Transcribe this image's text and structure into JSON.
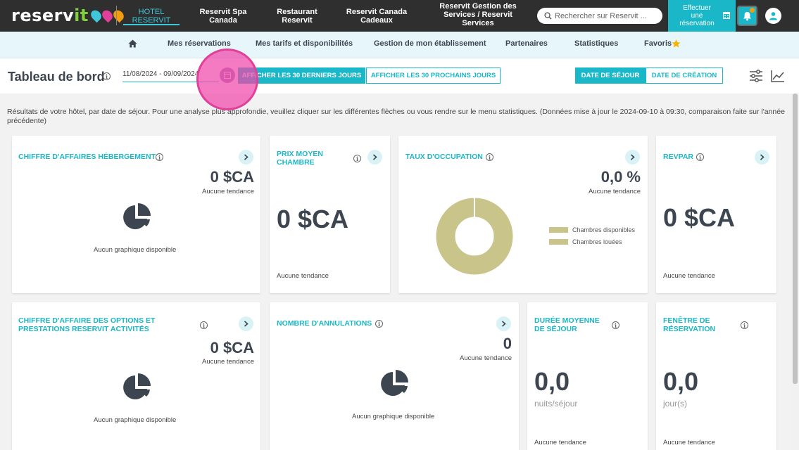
{
  "header": {
    "logo_text_a": "reserv",
    "logo_text_b": "it",
    "nav": [
      {
        "label_line1": "HOTEL",
        "label_line2": "RESERVIT",
        "active": true
      },
      {
        "label_line1": "Reservit Spa",
        "label_line2": "Canada"
      },
      {
        "label_line1": "Restaurant",
        "label_line2": "Reservit"
      },
      {
        "label_line1": "Reservit Canada",
        "label_line2": "Cadeaux"
      },
      {
        "label_line1": "Reservit Gestion des",
        "label_line2": "Services / Reservit",
        "label_line3": "Services"
      }
    ],
    "search_placeholder": "Rechercher sur Reservit ...",
    "reserve_button": {
      "line1": "Effectuer",
      "line2": "une",
      "line3": "réservation"
    }
  },
  "subnav": [
    "Mes réservations",
    "Mes tarifs et disponibilités",
    "Gestion de mon établissement",
    "Partenaires",
    "Statistiques",
    "Favoris"
  ],
  "toolbar": {
    "title": "Tableau de bord",
    "date_range": "11/08/2024 - 09/09/2024",
    "btn_last30": "AFFICHER LES 30 DERNIERS JOURS",
    "btn_next30": "AFFICHER LES 30 PROCHAINS JOURS",
    "btn_sejour": "DATE DE SÉJOUR",
    "btn_creation": "DATE DE CRÉATION"
  },
  "description": "Résultats de votre hôtel, par date de séjour. Pour une analyse plus approfondie, veuillez cliquer sur les différentes flèches ou vous rendre sur le menu statistiques. (Données mise à jour le 2024-09-10 à 09:30, comparaison faite sur l'année précédente)",
  "cards": {
    "ca_hebergement": {
      "title": "CHIFFRE D'AFFAIRES HÉBERGEMENT",
      "value": "0 $CA",
      "trend": "Aucune tendance",
      "no_chart": "Aucun graphique disponible"
    },
    "prix_moyen": {
      "title_line1": "PRIX MOYEN",
      "title_line2": "CHAMBRE",
      "value": "0 $CA",
      "trend": "Aucune tendance"
    },
    "taux_occupation": {
      "title": "TAUX D'OCCUPATION",
      "value": "0,0 %",
      "trend": "Aucune tendance",
      "legend": [
        "Chambres disponibles",
        "Chambres louées"
      ]
    },
    "revpar": {
      "title": "REVPAR",
      "value": "0 $CA",
      "trend": "Aucune tendance"
    },
    "ca_options": {
      "title_line1": "CHIFFRE D'AFFAIRE DES OPTIONS ET",
      "title_line2": "PRESTATIONS RESERVIT ACTIVITÉS",
      "value": "0 $CA",
      "trend": "Aucune tendance",
      "no_chart": "Aucun graphique disponible"
    },
    "annulations": {
      "title": "NOMBRE D'ANNULATIONS",
      "value": "0",
      "trend": "Aucune tendance",
      "no_chart": "Aucun graphique disponible"
    },
    "duree_sejour": {
      "title_line1": "DURÉE MOYENNE",
      "title_line2": "DE SÉJOUR",
      "value": "0,0",
      "unit": "nuits/séjour",
      "trend": "Aucune tendance"
    },
    "fenetre": {
      "title_line1": "FENÊTRE DE",
      "title_line2": "RÉSERVATION",
      "value": "0,0",
      "unit": "jour(s)",
      "trend": "Aucune tendance"
    }
  },
  "colors": {
    "accent": "#1ab7c8",
    "header_bg": "#2f2f2f",
    "donut": "#c8c48a",
    "highlight": "#e0409a"
  }
}
